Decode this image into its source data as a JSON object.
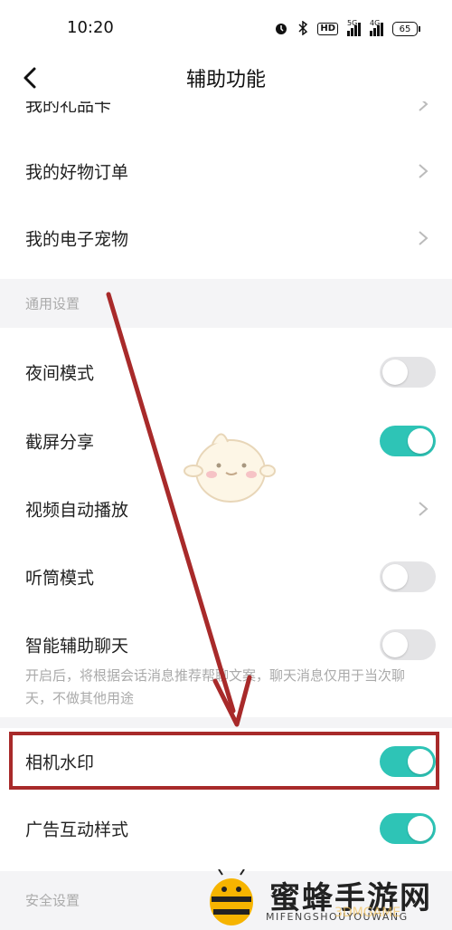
{
  "status_bar": {
    "time": "10:20",
    "hd_label": "HD",
    "sig1_label": "5G",
    "sig2_label": "4G",
    "battery": "65"
  },
  "nav": {
    "title": "辅助功能"
  },
  "items": {
    "gift_card": "我的礼品卡",
    "goods_order": "我的好物订单",
    "e_pet": "我的电子宠物"
  },
  "general_section": {
    "title": "通用设置"
  },
  "settings": {
    "night_mode": {
      "label": "夜间模式",
      "on": false
    },
    "screenshot_share": {
      "label": "截屏分享",
      "on": true
    },
    "video_autoplay": {
      "label": "视频自动播放"
    },
    "earpiece_mode": {
      "label": "听筒模式",
      "on": false
    },
    "smart_chat": {
      "label": "智能辅助聊天",
      "on": false,
      "desc": "开启后，将根据会话消息推荐帮聊文案，聊天消息仅用于当次聊天，不做其他用途"
    },
    "camera_watermark": {
      "label": "相机水印",
      "on": true
    },
    "ad_style": {
      "label": "广告互动样式",
      "on": true
    }
  },
  "security_section": {
    "title": "安全设置"
  },
  "watermark": {
    "text": "蜜蜂手游网",
    "sub": "MIFENGSHOUYOUWANG",
    "overlay": "3DMGAME"
  },
  "colors": {
    "toggle_on": "#2ec4b6",
    "toggle_off": "#e4e4e6",
    "annotation_red": "#a82a2a"
  }
}
